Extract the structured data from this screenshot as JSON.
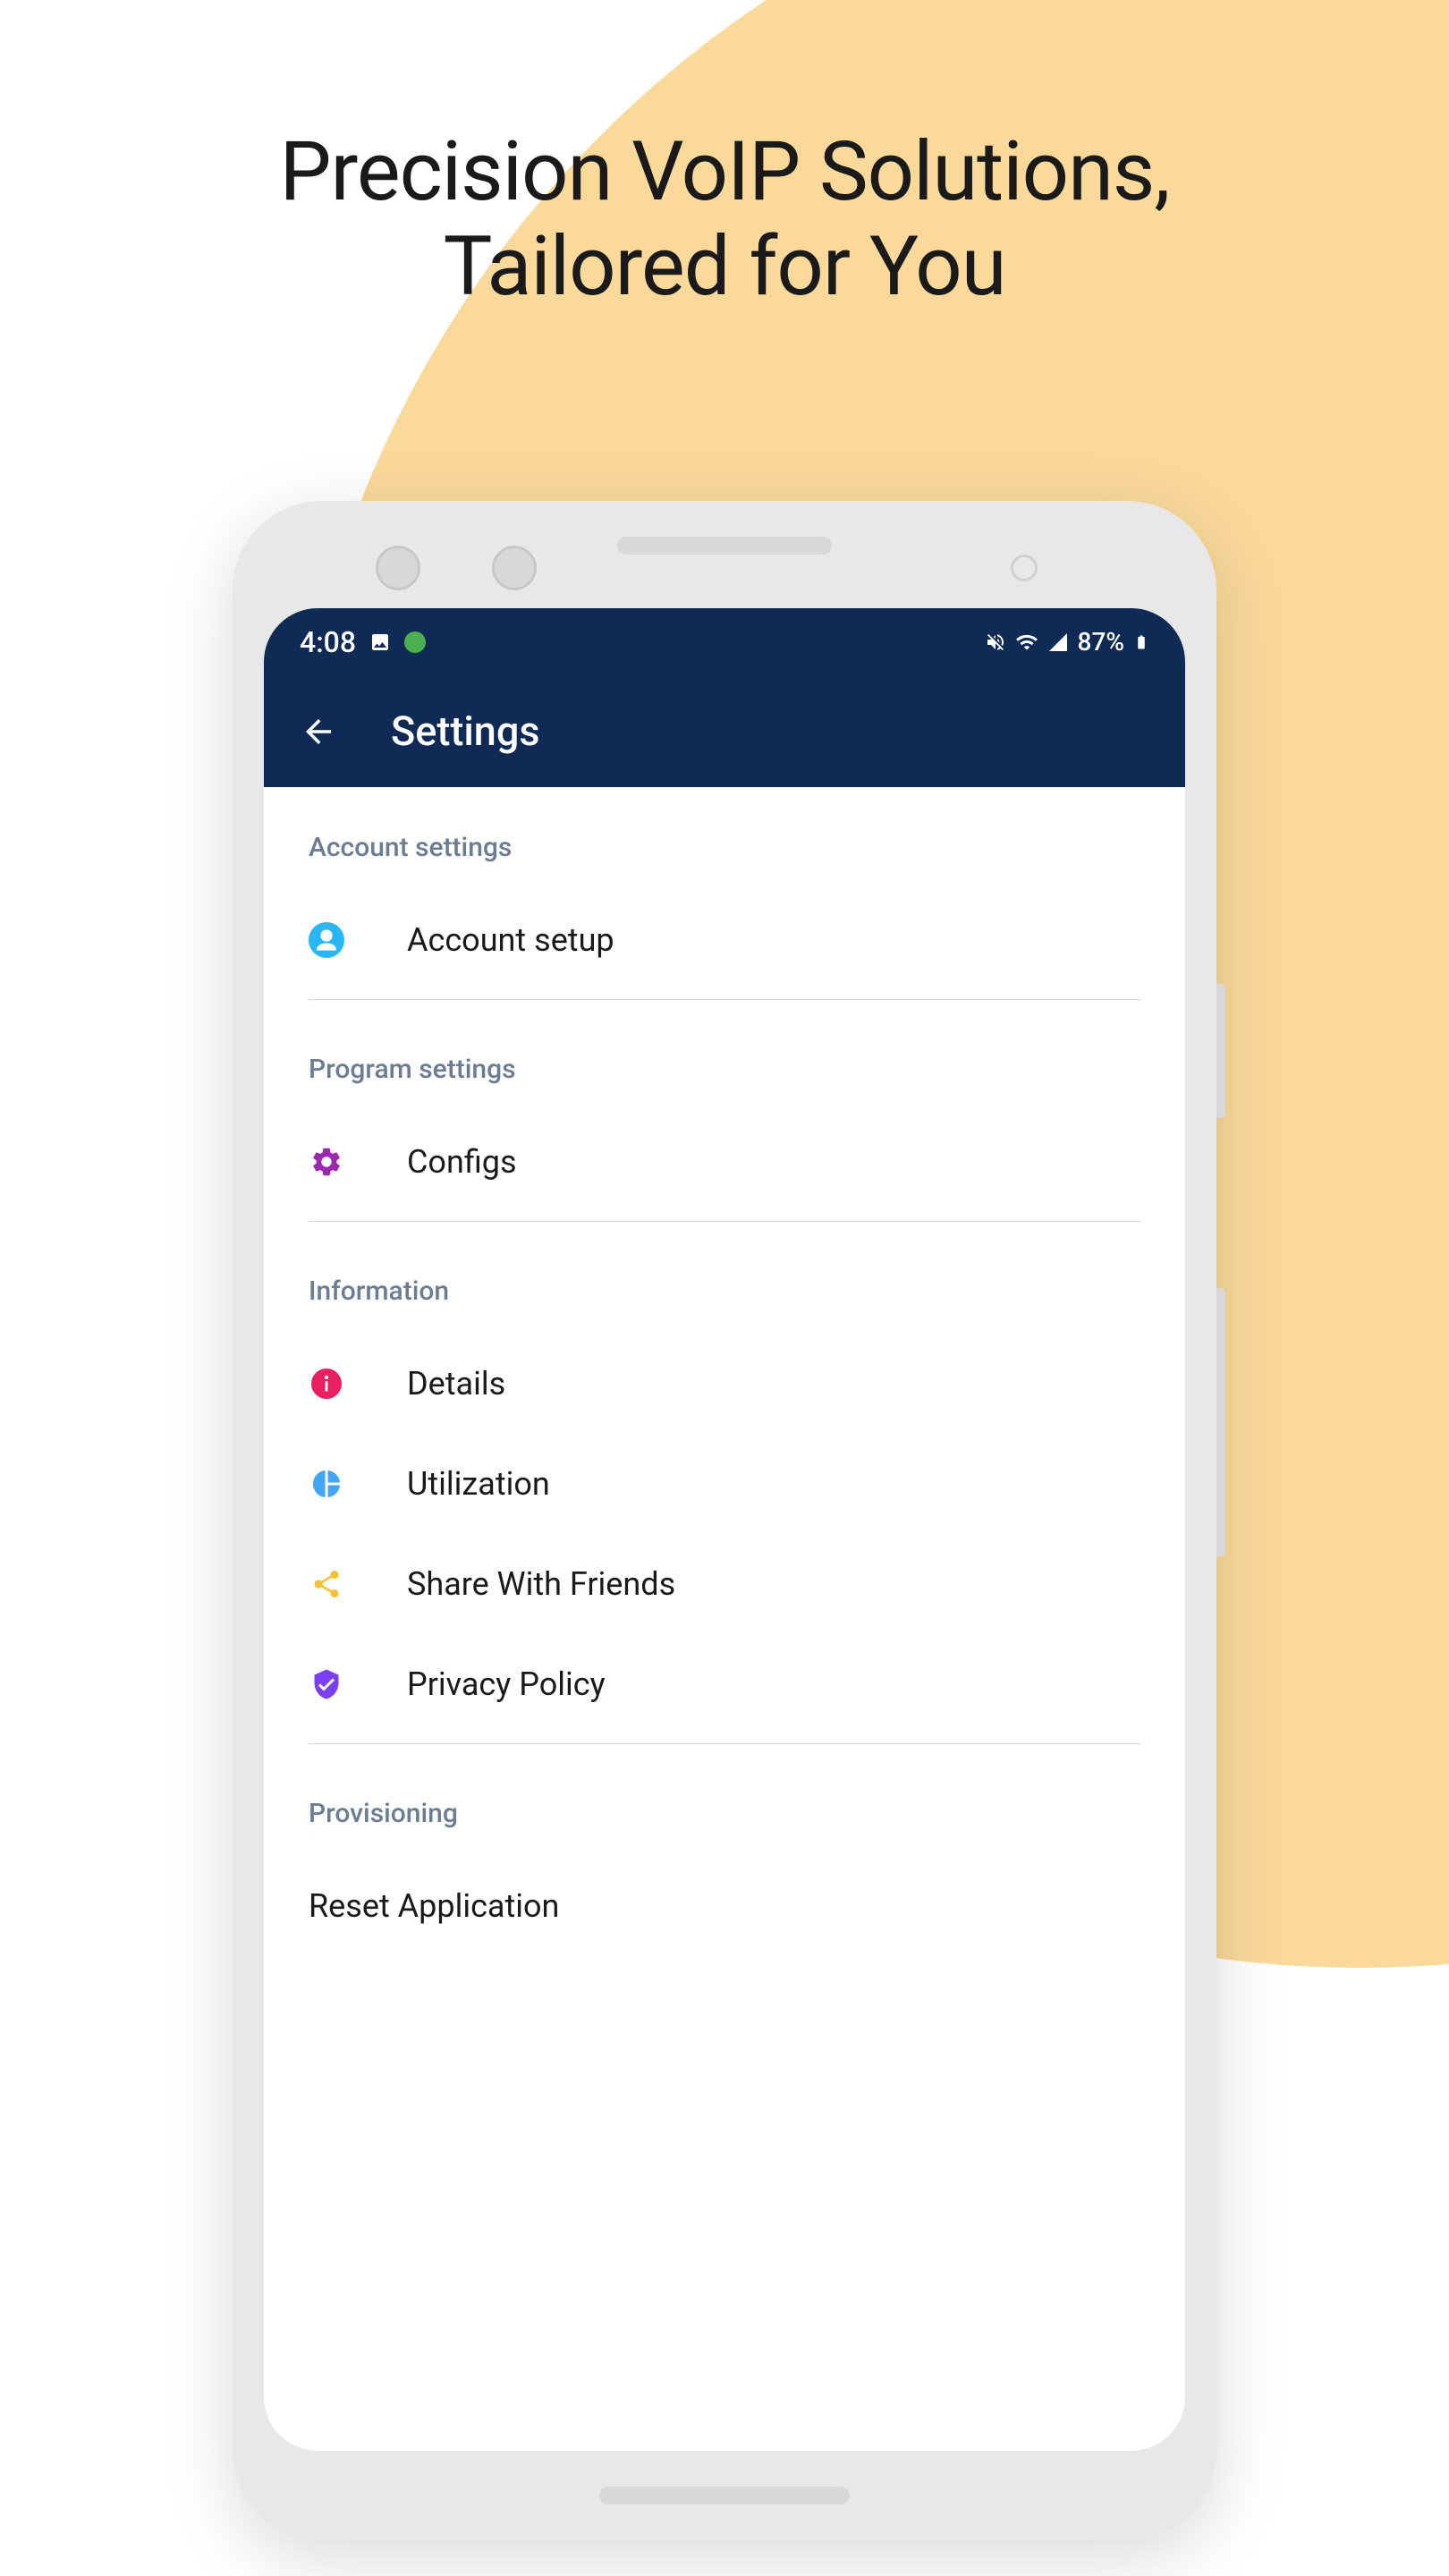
{
  "headline": {
    "line1": "Precision VoIP Solutions,",
    "line2": "Tailored for You"
  },
  "statusBar": {
    "time": "4:08",
    "battery": "87%"
  },
  "appBar": {
    "title": "Settings"
  },
  "sections": {
    "account": {
      "header": "Account settings",
      "items": {
        "setup": "Account setup"
      }
    },
    "program": {
      "header": "Program settings",
      "items": {
        "configs": "Configs"
      }
    },
    "information": {
      "header": "Information",
      "items": {
        "details": "Details",
        "utilization": "Utilization",
        "share": "Share With Friends",
        "privacy": "Privacy Policy"
      }
    },
    "provisioning": {
      "header": "Provisioning",
      "items": {
        "reset": "Reset Application"
      }
    }
  },
  "colors": {
    "navbarBg": "#0f2b55",
    "bgCircle": "#fbd99b",
    "iconUser": "#29b6f6",
    "iconGear": "#9c27b0",
    "iconInfo": "#e91e63",
    "iconChart": "#42a5f5",
    "iconShare": "#fbc02d",
    "iconShield": "#7b3ff2"
  }
}
